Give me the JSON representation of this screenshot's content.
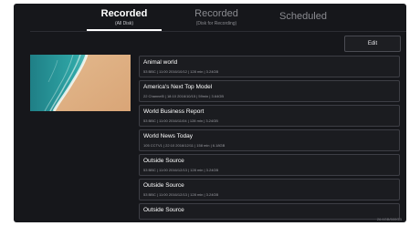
{
  "tabs": [
    {
      "label": "Recorded",
      "sub": "(All Disk)",
      "active": true
    },
    {
      "label": "Recorded",
      "sub": "(Disk for Recording)",
      "active": false
    },
    {
      "label": "Scheduled",
      "sub": "",
      "active": false
    }
  ],
  "edit_label": "Edit",
  "recordings": [
    {
      "title": "Animal world",
      "meta": "53 BBC | 11:00 2016/10/12 | 128 min | 3.24GB"
    },
    {
      "title": "America's Next Top Model",
      "meta": "22 Channel5 | 18:10 2016/10/15 | 59min | 3.64GB"
    },
    {
      "title": "World Business Report",
      "meta": "53 BBC | 11:00 2016/11/04 | 128 min | 3.24GB"
    },
    {
      "title": "World News Today",
      "meta": "105 CCTV1 | 22:10 2016/12/11 | 158 min | 6.18GB"
    },
    {
      "title": "Outside Source",
      "meta": "53 BBC | 11:00 2016/12/13 | 128 min | 3.24GB"
    },
    {
      "title": "Outside Source",
      "meta": "53 BBC | 11:00 2016/12/13 | 128 min | 3.24GB"
    },
    {
      "title": "Outside Source",
      "meta": ""
    }
  ],
  "storage": "26.6GB/500GB",
  "colors": {
    "background": "#16171b",
    "item_border": "#3d3e45",
    "accent": "#ffffff"
  }
}
